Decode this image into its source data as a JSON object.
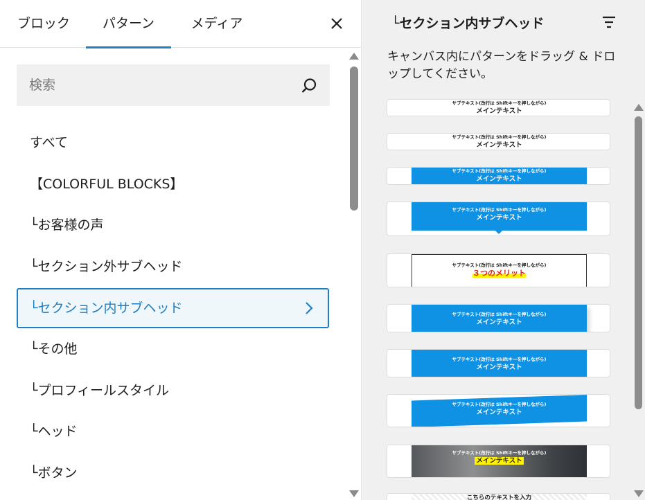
{
  "tabs": {
    "block": "ブロック",
    "pattern": "パターン",
    "media": "メディア"
  },
  "search": {
    "placeholder": "検索"
  },
  "categories": [
    {
      "label": "すべて"
    },
    {
      "label": "【COLORFUL BLOCKS】"
    },
    {
      "label": "└お客様の声"
    },
    {
      "label": "└セクション外サブヘッド"
    },
    {
      "label": "└セクション内サブヘッド"
    },
    {
      "label": "└その他"
    },
    {
      "label": "└プロフィールスタイル"
    },
    {
      "label": "└ヘッド"
    },
    {
      "label": "└ボタン"
    }
  ],
  "right": {
    "title": "└セクション内サブヘッド",
    "hint": "キャンバス内にパターンをドラッグ & ドロップしてください。"
  },
  "patterns": {
    "sub_text": "サブテキスト(改行は Shiftキーを押しながら)",
    "main_text": "メインテキスト",
    "merit_text": "３つのメリット",
    "last_text": "こちらのテキストを入力"
  },
  "colors": {
    "accent": "#1f7fc4",
    "pattern_blue": "#0f92e3",
    "highlight_yellow": "#fff200"
  }
}
